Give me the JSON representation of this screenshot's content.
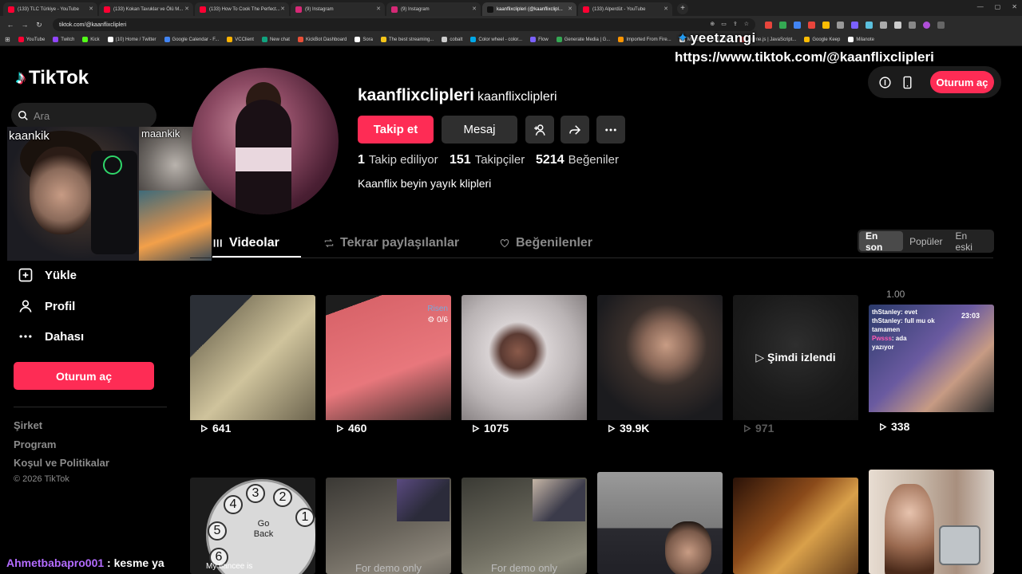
{
  "browser": {
    "tabs": [
      {
        "title": "(133) TLC Türkiye - YouTube",
        "color": "#ff0033",
        "active": false
      },
      {
        "title": "(133) Kokan Tavuklar ve Ölü M...",
        "color": "#ff0033",
        "active": false
      },
      {
        "title": "(133) How To Cook The Perfect...",
        "color": "#ff0033",
        "active": false
      },
      {
        "title": "(9) Instagram",
        "color": "#d62976",
        "active": false
      },
      {
        "title": "(9) Instagram",
        "color": "#d62976",
        "active": false
      },
      {
        "title": "kaanflixclipleri (@kaanflixclipl...",
        "color": "#111111",
        "active": true
      },
      {
        "title": "(133) Alperdüt - YouTube",
        "color": "#ff0033",
        "active": false
      }
    ],
    "new_tab": "+",
    "url": "tiktok.com/@kaanflixclipleri",
    "bookmarks": [
      {
        "label": "YouTube",
        "color": "#ff0033"
      },
      {
        "label": "Twitch",
        "color": "#9146ff"
      },
      {
        "label": "Kick",
        "color": "#53fc18"
      },
      {
        "label": "(10) Home / Twitter",
        "color": "#ffffff"
      },
      {
        "label": "Google Calendar - F...",
        "color": "#4285f4"
      },
      {
        "label": "VCClient",
        "color": "#ffb300"
      },
      {
        "label": "New chat",
        "color": "#10a37f"
      },
      {
        "label": "KickBot Dashboard",
        "color": "#e94f37"
      },
      {
        "label": "Sora",
        "color": "#ffffff"
      },
      {
        "label": "The best streaming...",
        "color": "#f5c518"
      },
      {
        "label": "cobalt",
        "color": "#cccccc"
      },
      {
        "label": "Color wheel - color...",
        "color": "#00a8e8"
      },
      {
        "label": "Flow",
        "color": "#7b61ff"
      },
      {
        "label": "Generate Media | G...",
        "color": "#34a853"
      },
      {
        "label": "Imported From Fire...",
        "color": "#ff9500"
      },
      {
        "label": "Mobbin — UI & UX...",
        "color": "#ffffff"
      },
      {
        "label": "Anime.js | JavaScript...",
        "color": "#ff4b4b"
      },
      {
        "label": "Google Keep",
        "color": "#fbbc04"
      },
      {
        "label": "Milanote",
        "color": "#ffffff"
      }
    ]
  },
  "overlay": {
    "brand": "yeet",
    "brand_rest": "zangi",
    "url": "https://www.tiktok.com/@kaanflixclipleri",
    "cam_label_main": "kaankik",
    "cam_label_side": "maankik",
    "chat_user": "Ahmetbabapro001",
    "chat_msg": ": kesme ya"
  },
  "nav": {
    "logo": "TikTok",
    "search_placeholder": "Ara",
    "items": [
      {
        "label": "Yükle",
        "icon": "upload-icon"
      },
      {
        "label": "Profil",
        "icon": "profile-icon"
      },
      {
        "label": "Dahası",
        "icon": "more-icon"
      }
    ],
    "login": "Oturum aç",
    "footer": [
      "Şirket",
      "Program",
      "Koşul ve Politikalar"
    ],
    "copyright": "© 2026 TikTok"
  },
  "profile": {
    "username": "kaanflixclipleri",
    "nickname": "kaanflixclipleri",
    "follow": "Takip et",
    "message": "Mesaj",
    "stats": [
      {
        "value": "1",
        "label": "Takip ediliyor"
      },
      {
        "value": "151",
        "label": "Takipçiler"
      },
      {
        "value": "5214",
        "label": "Beğeniler"
      }
    ],
    "bio": "Kaanflix beyin yayık klipleri"
  },
  "topright": {
    "login": "Oturum aç"
  },
  "tabs": [
    {
      "label": "Videolar",
      "active": true
    },
    {
      "label": "Tekrar paylaşılanlar",
      "active": false
    },
    {
      "label": "Beğenilenler",
      "active": false
    }
  ],
  "sort": [
    {
      "label": "En son",
      "active": true
    },
    {
      "label": "Popüler",
      "active": false
    },
    {
      "label": "En eski",
      "active": false
    }
  ],
  "speed_label": "1.00",
  "videos_row1": [
    {
      "views": "641",
      "theme": "#8d8468"
    },
    {
      "views": "460",
      "theme": "#d9646a"
    },
    {
      "views": "1075",
      "theme": "#b9b3b4"
    },
    {
      "views": "39.9K",
      "theme": "#5b5048"
    },
    {
      "views": "971",
      "theme": "#1a1a1a",
      "watched": "Şimdi izlendi"
    },
    {
      "views": "338",
      "theme": "#3a4a7a"
    }
  ],
  "videos_row2": [
    {
      "theme": "#c9c9c9",
      "dial": [
        "4",
        "3",
        "2",
        "5",
        "1",
        "6"
      ],
      "dial_center": "Go Back",
      "caption": "My fiancee is"
    },
    {
      "theme": "#5a5650",
      "caption": "For demo only"
    },
    {
      "theme": "#5c5a52",
      "caption": "For demo only"
    },
    {
      "theme": "#3d3d45"
    },
    {
      "theme": "#4a2a14"
    },
    {
      "theme": "#c7b8a9"
    }
  ],
  "video_overlays": {
    "v2_tag": "Risen",
    "v2_count": "0/6",
    "v6_name": "thStanley",
    "v6_line1": ": evet",
    "v6_line2": ": full mu ok",
    "v6_line3": "tamamen",
    "v6_user2": "Pwsss",
    "v6_line4": ": ada",
    "v6_line5": "yazıyor",
    "v6_time": "23:03"
  }
}
